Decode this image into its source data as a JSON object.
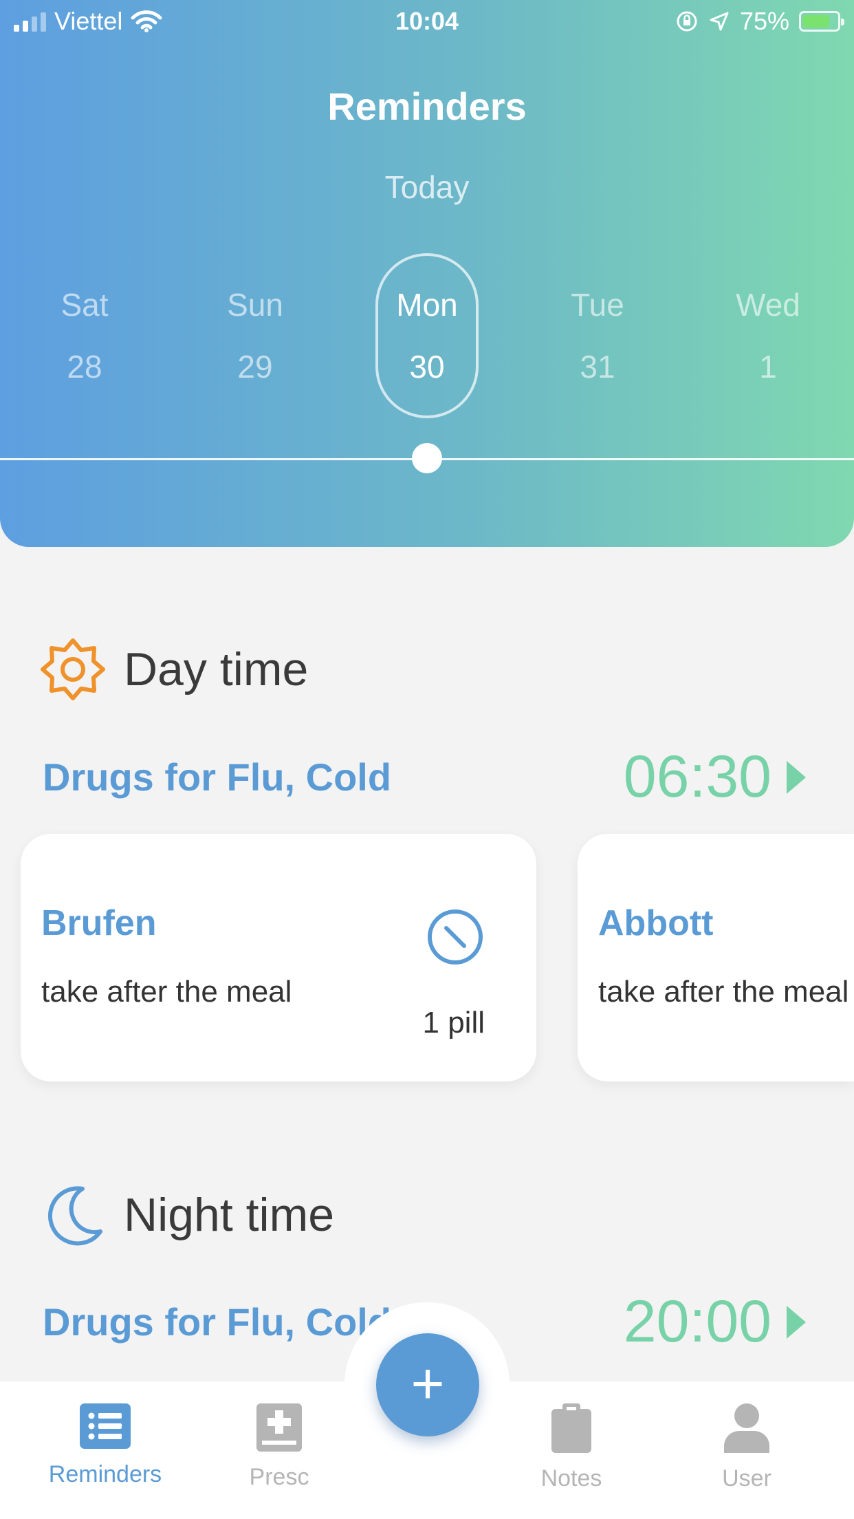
{
  "status": {
    "carrier": "Viettel",
    "time": "10:04",
    "battery": "75%"
  },
  "header": {
    "title": "Reminders",
    "subtitle": "Today",
    "days": [
      {
        "name": "Sat",
        "date": "28"
      },
      {
        "name": "Sun",
        "date": "29"
      },
      {
        "name": "Mon",
        "date": "30",
        "selected": true
      },
      {
        "name": "Tue",
        "date": "31"
      },
      {
        "name": "Wed",
        "date": "1"
      }
    ]
  },
  "sections": {
    "day": {
      "title": "Day time",
      "icon": "sun-icon",
      "group_name": "Drugs for Flu, Cold",
      "group_time": "06:30",
      "cards": [
        {
          "name": "Brufen",
          "note": "take after the meal",
          "dose": "1 pill"
        },
        {
          "name": "Abbott",
          "note": "take after the meal"
        }
      ]
    },
    "night": {
      "title": "Night time",
      "icon": "moon-icon",
      "group_name": "Drugs for Flu, Cold",
      "group_time": "20:00"
    }
  },
  "fab": {
    "label": "+"
  },
  "tabs": [
    {
      "label": "Reminders",
      "icon": "list-icon",
      "active": true
    },
    {
      "label": "Presc",
      "icon": "prescription-book-icon"
    },
    {
      "label": "Notes",
      "icon": "clipboard-icon"
    },
    {
      "label": "User",
      "icon": "user-icon"
    }
  ],
  "colors": {
    "accent": "#5b9bd5",
    "time_green": "#78d2a8",
    "sun_orange": "#f0922b",
    "header_gradient_start": "#5d9fe0",
    "header_gradient_end": "#7fd8b0"
  }
}
